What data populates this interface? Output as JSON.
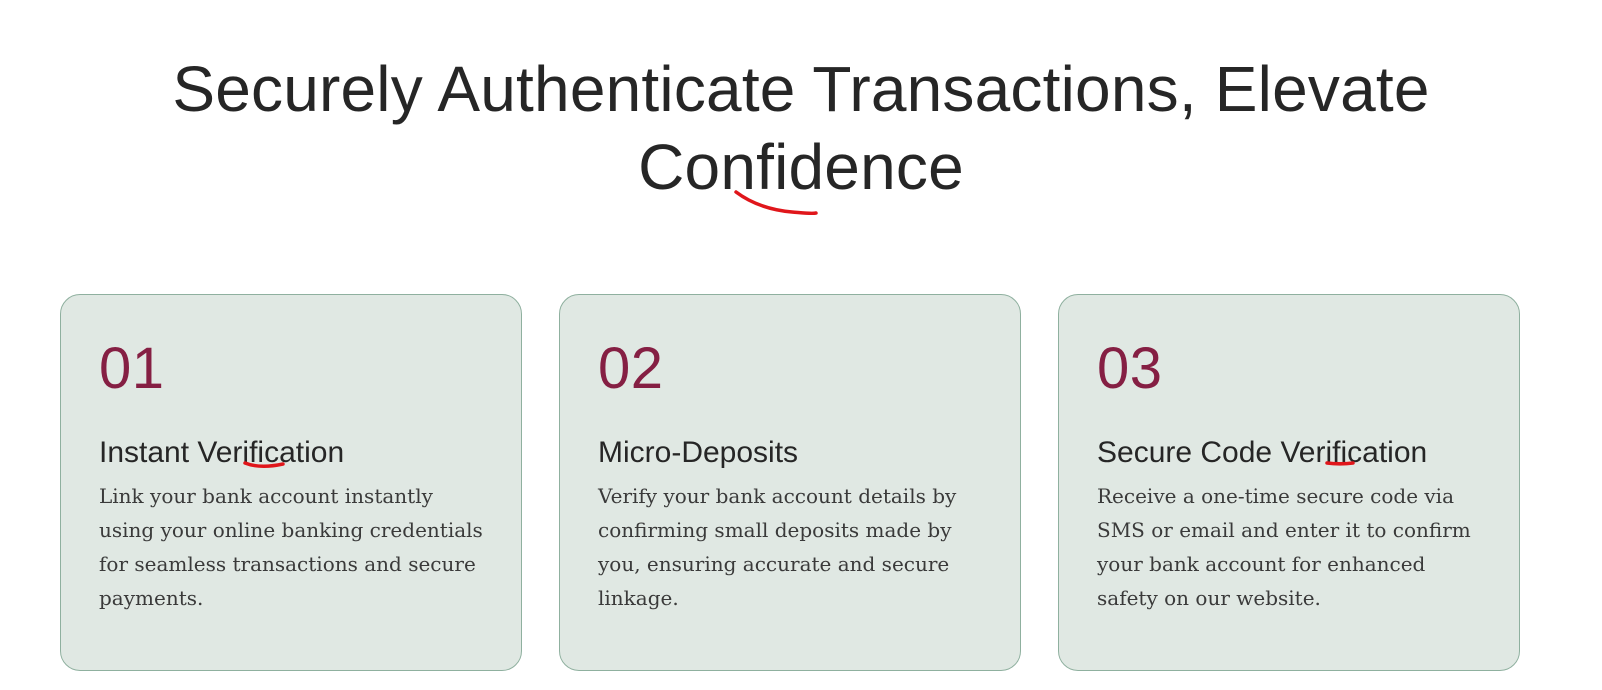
{
  "hero": {
    "title_line1": "Securely Authenticate Transactions, Elevate",
    "title_line2": "Confidence"
  },
  "cards": [
    {
      "number": "01",
      "title": "Instant Verification",
      "description": "Link your bank account instantly using your online banking credentials for seamless transactions and secure payments."
    },
    {
      "number": "02",
      "title": "Micro-Deposits",
      "description": "Verify your bank account details by confirming small deposits made by you, ensuring accurate and secure linkage."
    },
    {
      "number": "03",
      "title": "Secure Code Verification",
      "description": "Receive a one-time secure code via SMS or email and enter it to confirm your bank account for enhanced safety on our website."
    }
  ],
  "colors": {
    "accent_number": "#851f43",
    "card_background": "#e0e8e3",
    "card_border": "#8fb09f",
    "spellcheck_underline": "#e0161b"
  }
}
